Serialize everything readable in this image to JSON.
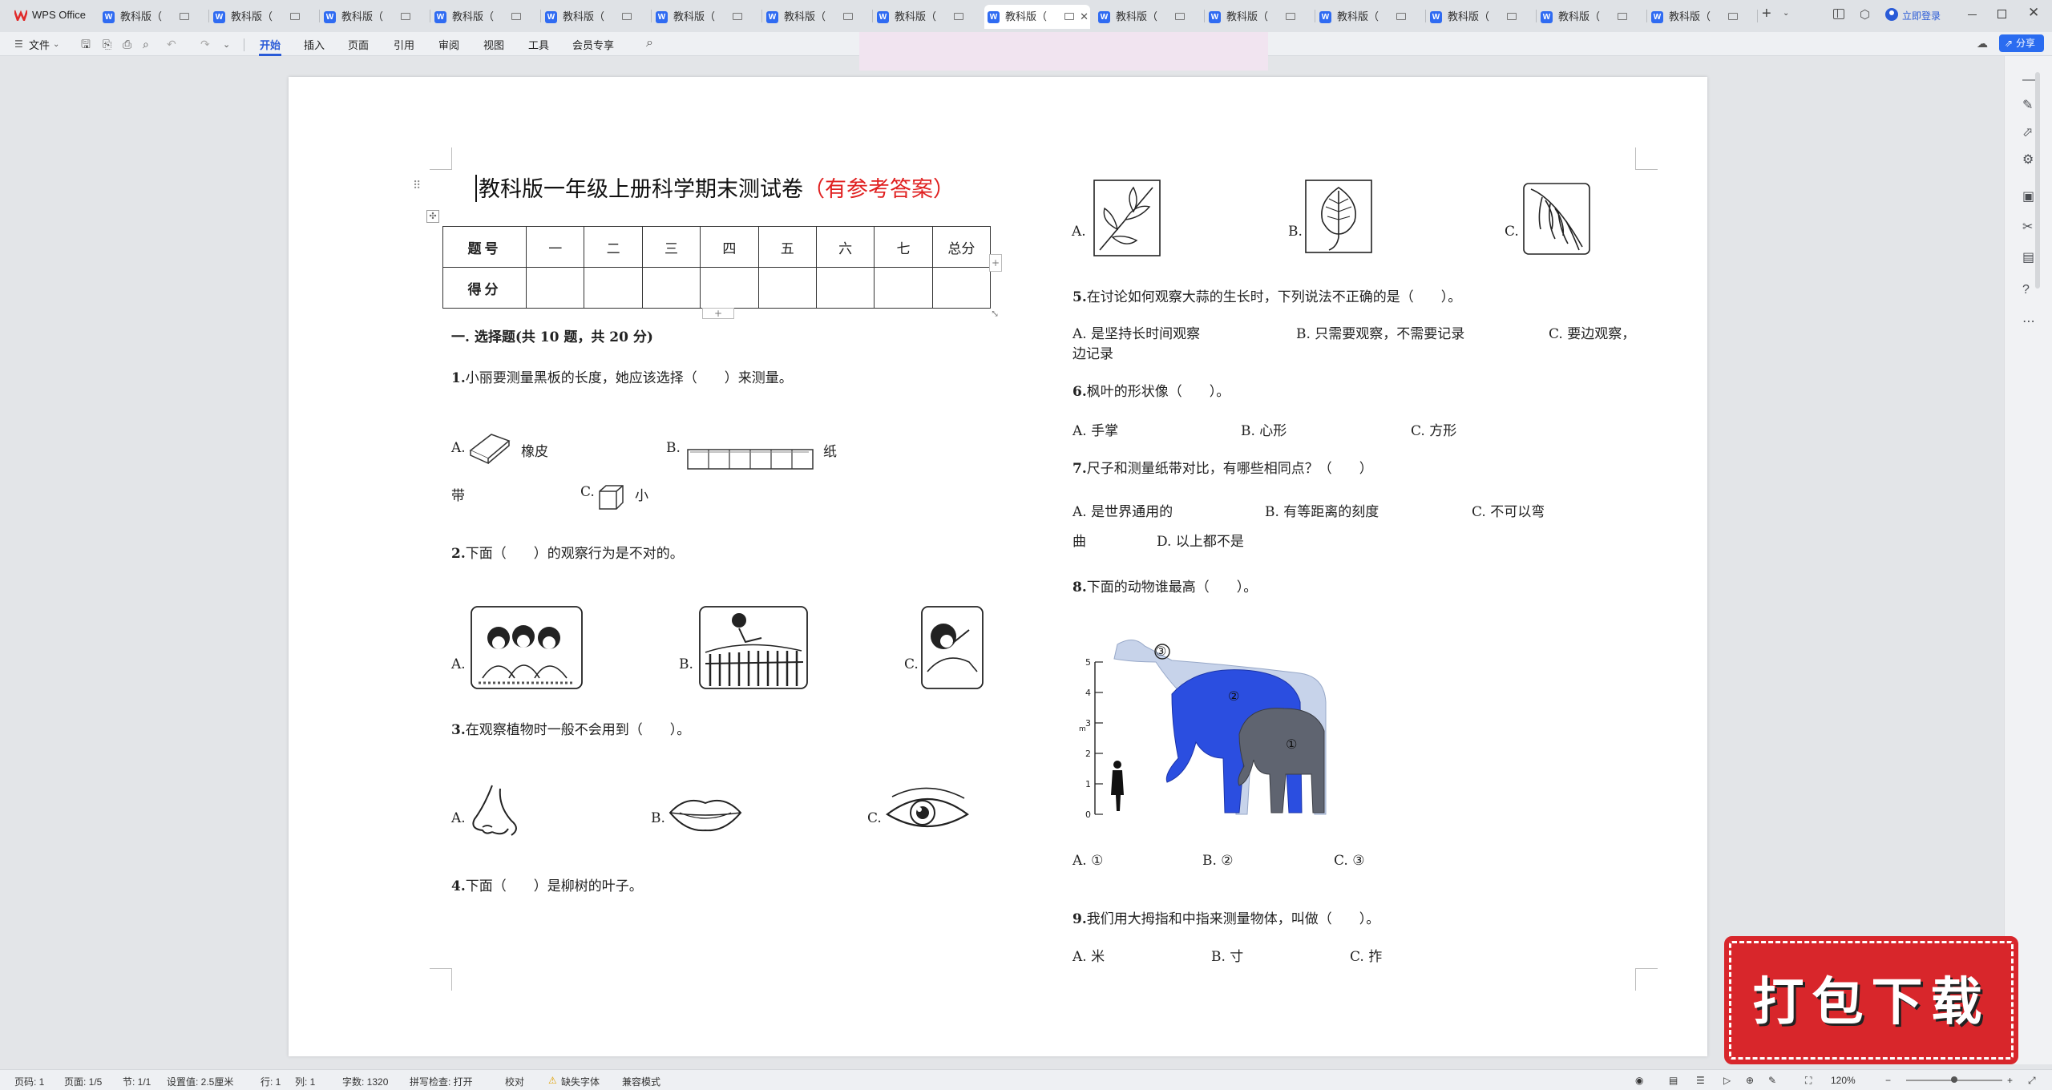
{
  "app": {
    "name": "WPS Office",
    "tab_title": "教科版（",
    "login": "立即登录",
    "share": "分享"
  },
  "ribbon": {
    "file": "文件",
    "tabs": [
      "开始",
      "插入",
      "页面",
      "引用",
      "审阅",
      "视图",
      "工具",
      "会员专享"
    ]
  },
  "doc": {
    "title": "教科版一年级上册科学期末测试卷",
    "title_suffix": "（有参考答案）",
    "table": {
      "row1": [
        "题号",
        "一",
        "二",
        "三",
        "四",
        "五",
        "六",
        "七",
        "总分"
      ],
      "row2_label": "得分"
    },
    "section1": "一. 选择题(共 10 题，共 20 分)",
    "q1": {
      "num": "1.",
      "text": "小丽要测量黑板的长度，她应该选择（　　）来测量。",
      "a": "A.",
      "a_text": "橡皮",
      "b": "B.",
      "b_text": "纸",
      "b_cont": "带",
      "c": "C.",
      "c_text": "小"
    },
    "q2": {
      "num": "2.",
      "text": "下面（　　）的观察行为是不对的。",
      "a": "A.",
      "b": "B.",
      "c": "C."
    },
    "q3": {
      "num": "3.",
      "text": "在观察植物时一般不会用到（　　）。",
      "a": "A.",
      "b": "B.",
      "c": "C."
    },
    "q4": {
      "num": "4.",
      "text": "下面（　　）是柳树的叶子。",
      "a": "A.",
      "b": "B.",
      "c": "C."
    },
    "q5": {
      "num": "5.",
      "text": "在讨论如何观察大蒜的生长时，下列说法不正确的是（　　）。",
      "a": "A. 是坚持长时间观察",
      "b": "B. 只需要观察，不需要记录",
      "c": "C. 要边观察，",
      "c_cont": "边记录"
    },
    "q6": {
      "num": "6.",
      "text": "枫叶的形状像（　　）。",
      "a": "A. 手掌",
      "b": "B. 心形",
      "c": "C. 方形"
    },
    "q7": {
      "num": "7.",
      "text": "尺子和测量纸带对比，有哪些相同点？（　　）",
      "a": "A. 是世界通用的",
      "b": "B. 有等距离的刻度",
      "c": "C. 不可以弯",
      "c_cont": "曲",
      "d": "D. 以上都不是"
    },
    "q8": {
      "num": "8.",
      "text": "下面的动物谁最高（　　）。",
      "a": "A. ①",
      "b": "B. ②",
      "c": "C. ③",
      "axis_ticks": [
        "0",
        "1",
        "2",
        "3",
        "4",
        "5"
      ],
      "axis_unit": "m",
      "labels": [
        "③",
        "②",
        "①"
      ]
    },
    "q9": {
      "num": "9.",
      "text": "我们用大拇指和中指来测量物体，叫做（　　）。",
      "a": "A. 米",
      "b": "B. 寸",
      "c": "C. 拃"
    }
  },
  "watermark": "打包下载",
  "status": {
    "page": "页码: 1",
    "pages": "页面: 1/5",
    "section": "节: 1/1",
    "setting": "设置值: 2.5厘米",
    "row": "行: 1",
    "col": "列: 1",
    "words": "字数: 1320",
    "spell": "拼写检查: 打开",
    "proof": "校对",
    "font_missing": "缺失字体",
    "compat": "兼容模式",
    "zoom": "120%"
  },
  "colors": {
    "accent": "#2a5bd7",
    "title_red": "#e02020",
    "watermark": "#d8262b"
  }
}
